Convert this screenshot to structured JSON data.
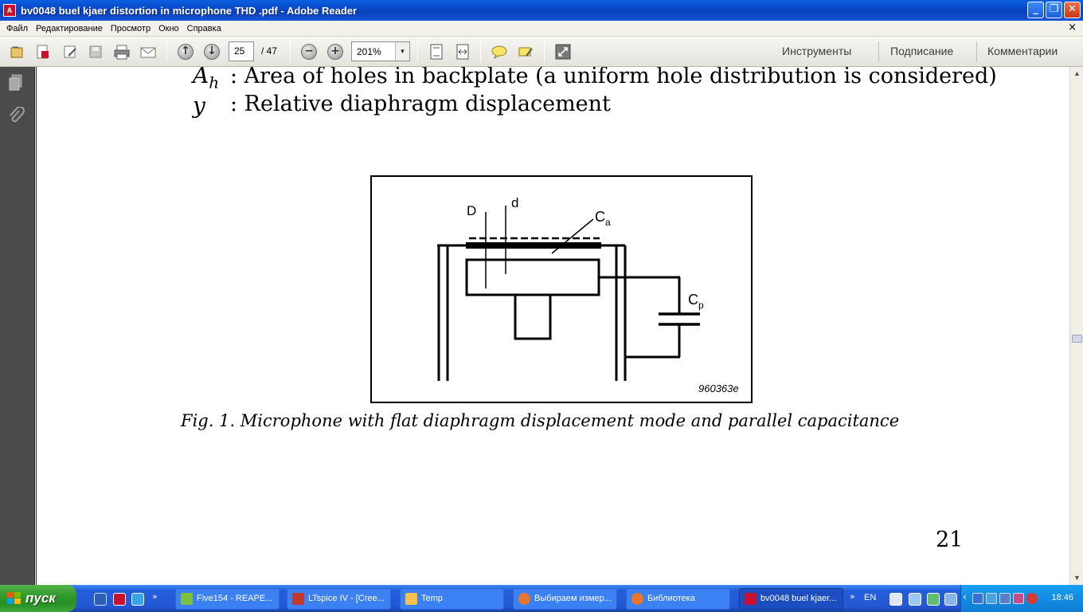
{
  "window": {
    "title": "bv0048 buel kjaer distortion in microphone THD .pdf - Adobe Reader",
    "app_icon_text": "A"
  },
  "menu": {
    "items": [
      "Файл",
      "Редактирование",
      "Просмотр",
      "Окно",
      "Справка"
    ],
    "close_glyph": "×"
  },
  "toolbar": {
    "page_current": "25",
    "page_total": "/ 47",
    "zoom": "201%",
    "right_links": [
      "Инструменты",
      "Подписание",
      "Комментарии"
    ]
  },
  "document": {
    "definitions": [
      {
        "symbol": "A",
        "subscript": "h",
        "text": ": Area of holes in backplate (a uniform hole distribution is considered)"
      },
      {
        "symbol": "y",
        "subscript": "",
        "text": ": Relative diaphragm displacement"
      }
    ],
    "figure": {
      "labels": {
        "D": "D",
        "d": "d",
        "Ca_main": "C",
        "Ca_sub": "a",
        "Cp_main": "C",
        "Cp_sub": "p"
      },
      "figure_id": "960363e"
    },
    "caption": "Fig. 1.  Microphone with flat diaphragm displacement mode and parallel capacitance",
    "page_number": "21"
  },
  "taskbar": {
    "start_label": "пуск",
    "tasks": [
      {
        "label": "Five154 - REAPE...",
        "icon_color": "#7fbf3f",
        "active": false
      },
      {
        "label": "LTspice IV - [Cree...",
        "icon_color": "#c0392b",
        "active": false
      },
      {
        "label": "Temp",
        "icon_color": "#f2c14e",
        "active": false
      },
      {
        "label": "Выбираем измер...",
        "icon_color": "#e8762b",
        "active": false
      },
      {
        "label": "Библиотека",
        "icon_color": "#e8762b",
        "active": false
      },
      {
        "label": "bv0048 buel kjaer...",
        "icon_color": "#c8102e",
        "active": true
      }
    ],
    "language": "EN",
    "clock": "18:46"
  }
}
